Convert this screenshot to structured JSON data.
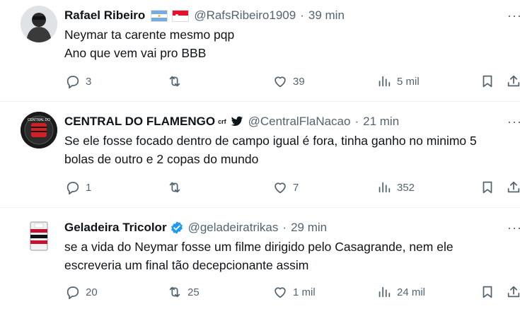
{
  "tweets": [
    {
      "name": "Rafael Ribeiro",
      "handle": "@RafsRibeiro1909",
      "dot": "·",
      "time": "39 min",
      "lines": [
        "Neymar ta carente mesmo pqp",
        "Ano que vem vai pro BBB"
      ],
      "replies": "3",
      "retweets": "",
      "likes": "39",
      "views": "5 mil",
      "more": "···"
    },
    {
      "name": "CENTRAL DO FLAMENGO",
      "name_badge": "crf",
      "handle": "@CentralFlaNacao",
      "dot": "·",
      "time": "21 min",
      "lines": [
        "Se ele fosse focado dentro de campo igual é fora, tinha ganho no minimo 5",
        "bolas de outro e 2 copas do mundo"
      ],
      "avatar_text": "CENTRAL DO FLAMENGO",
      "replies": "1",
      "retweets": "",
      "likes": "7",
      "views": "352",
      "more": "···"
    },
    {
      "name": "Geladeira Tricolor",
      "handle": "@geladeiratrikas",
      "dot": "·",
      "time": "29 min",
      "lines": [
        "se a vida do Neymar fosse um filme dirigido pelo Casagrande, nem ele",
        "escreveria um final tão decepcionante assim"
      ],
      "replies": "20",
      "retweets": "25",
      "likes": "1 mil",
      "views": "24 mil",
      "more": "···"
    }
  ],
  "colors": {
    "text": "#0f1419",
    "muted": "#536471",
    "verified": "#1d9bf0",
    "separator": "#eff3f4"
  },
  "icons": [
    "reply-icon",
    "retweet-icon",
    "like-icon",
    "views-icon",
    "bookmark-icon",
    "share-icon",
    "more-icon",
    "verified-badge-icon",
    "bird-icon"
  ]
}
